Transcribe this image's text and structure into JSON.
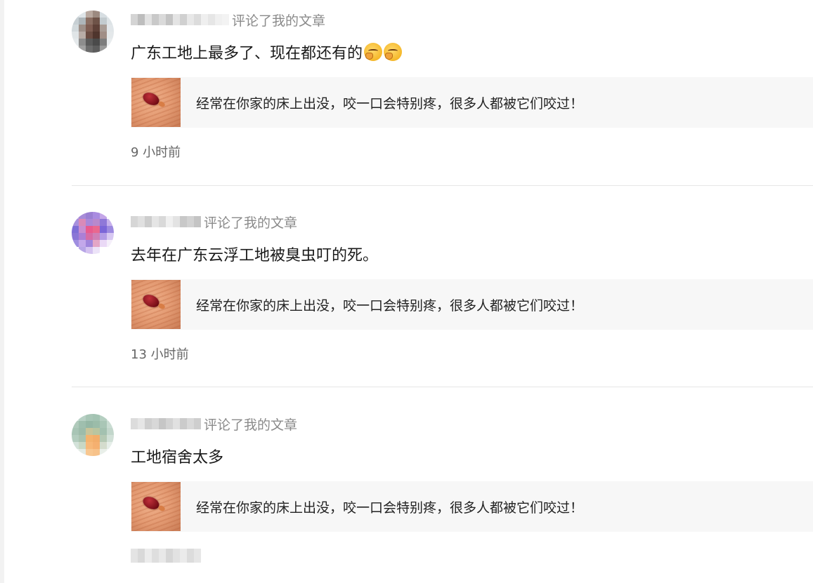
{
  "comments": [
    {
      "action": "评论了我的文章",
      "body": "广东工地上最多了、现在都还有的",
      "emojis": [
        "thinking-face-icon",
        "thinking-face-icon"
      ],
      "article_title": "经常在你家的床上出没，咬一口会特别疼，很多人都被它们咬过！",
      "timestamp": "9 小时前"
    },
    {
      "action": "评论了我的文章",
      "body": "去年在广东云浮工地被臭虫叮的死。",
      "emojis": [],
      "article_title": "经常在你家的床上出没，咬一口会特别疼，很多人都被它们咬过！",
      "timestamp": "13 小时前"
    },
    {
      "action": "评论了我的文章",
      "body": "工地宿舍太多",
      "emojis": [],
      "article_title": "经常在你家的床上出没，咬一口会特别疼，很多人都被它们咬过！",
      "timestamp": ""
    }
  ],
  "colors": {
    "action_text": "#8a8a8a",
    "card_background": "#f7f7f7",
    "divider": "#e6e6e6"
  }
}
